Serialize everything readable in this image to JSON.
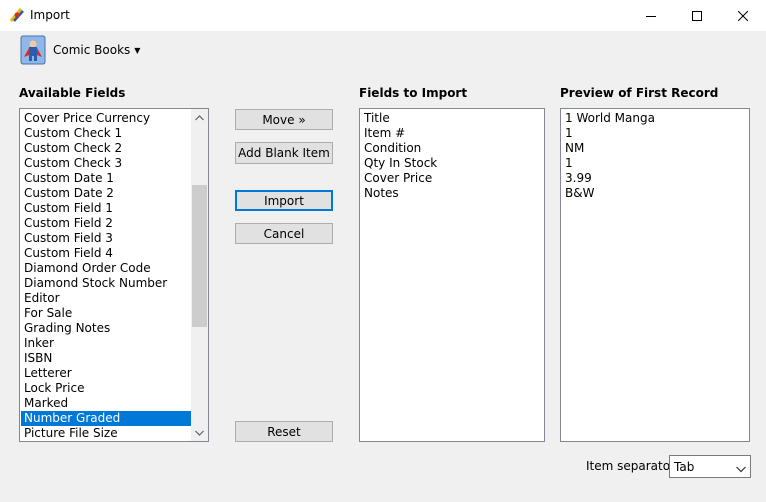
{
  "window": {
    "title": "Import"
  },
  "toolbar": {
    "database_label": "Comic Books"
  },
  "sections": {
    "available": "Available Fields",
    "to_import": "Fields to Import",
    "preview": "Preview of First Record"
  },
  "available_fields": [
    "Cover Price Currency",
    "Custom Check 1",
    "Custom Check 2",
    "Custom Check 3",
    "Custom Date 1",
    "Custom Date 2",
    "Custom Field 1",
    "Custom Field 2",
    "Custom Field 3",
    "Custom Field 4",
    "Diamond Order Code",
    "Diamond Stock Number",
    "Editor",
    "For Sale",
    "Grading Notes",
    "Inker",
    "ISBN",
    "Letterer",
    "Lock Price",
    "Marked",
    "Number Graded",
    "Picture File Size"
  ],
  "selected_available_field": "Number Graded",
  "fields_to_import": [
    "Title",
    "Item #",
    "Condition",
    "Qty In Stock",
    "Cover Price",
    "Notes"
  ],
  "preview_values": [
    "1 World Manga",
    "1",
    "NM",
    "1",
    "3.99",
    "B&W"
  ],
  "buttons": {
    "move": "Move »",
    "add_blank": "Add Blank Item",
    "import": "Import",
    "cancel": "Cancel",
    "reset": "Reset"
  },
  "separator": {
    "label": "Item separator",
    "value": "Tab"
  },
  "colors": {
    "selection": "#0078d7",
    "background": "#f0f0f0"
  }
}
